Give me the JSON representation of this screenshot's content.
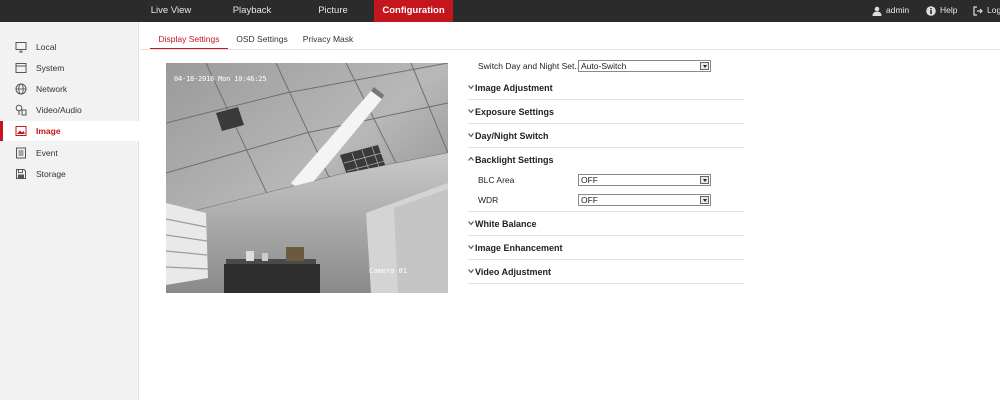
{
  "topnav": {
    "tabs": [
      {
        "label": "Live View"
      },
      {
        "label": "Playback"
      },
      {
        "label": "Picture"
      },
      {
        "label": "Configuration"
      }
    ],
    "active_tab": "Configuration",
    "user": "admin",
    "help": "Help",
    "logout": "Log"
  },
  "sidebar": {
    "items": [
      {
        "label": "Local",
        "icon": "monitor-icon"
      },
      {
        "label": "System",
        "icon": "system-icon"
      },
      {
        "label": "Network",
        "icon": "network-icon"
      },
      {
        "label": "Video/Audio",
        "icon": "video-audio-icon"
      },
      {
        "label": "Image",
        "icon": "image-icon"
      },
      {
        "label": "Event",
        "icon": "event-icon"
      },
      {
        "label": "Storage",
        "icon": "storage-icon"
      }
    ],
    "active": "Image"
  },
  "subtabs": [
    {
      "label": "Display Settings"
    },
    {
      "label": "OSD Settings"
    },
    {
      "label": "Privacy Mask"
    }
  ],
  "preview": {
    "osd_time": "04-18-2016 Mon 10:46:25",
    "osd_camera": "Camera 01"
  },
  "settings": {
    "day_night": {
      "label": "Switch Day and Night Set...",
      "value": "Auto-Switch"
    },
    "sections": {
      "image_adjustment": "Image Adjustment",
      "exposure": "Exposure Settings",
      "day_night_switch": "Day/Night Switch",
      "backlight": "Backlight Settings",
      "white_balance": "White Balance",
      "image_enhancement": "Image Enhancement",
      "video_adjustment": "Video Adjustment"
    },
    "blc_area": {
      "label": "BLC Area",
      "value": "OFF"
    },
    "wdr": {
      "label": "WDR",
      "value": "OFF"
    }
  },
  "colors": {
    "accent": "#c4161c",
    "topbar": "#2b2b2b",
    "sidebar": "#f2f2f2"
  }
}
